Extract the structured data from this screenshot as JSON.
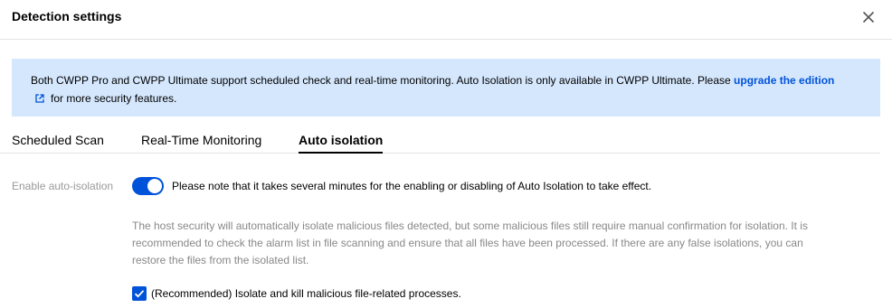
{
  "dialog": {
    "title": "Detection settings"
  },
  "notice": {
    "text_before_link": "Both CWPP Pro and CWPP Ultimate support scheduled check and real-time monitoring. Auto Isolation is only available in CWPP Ultimate. Please ",
    "link_label": "upgrade the edition",
    "text_after_link": "for more security features.",
    "background_color": "#d5e7fd",
    "link_color": "#0052d9"
  },
  "tabs": [
    {
      "label": "Scheduled Scan",
      "active": false
    },
    {
      "label": "Real-Time Monitoring",
      "active": false
    },
    {
      "label": "Auto isolation",
      "active": true
    }
  ],
  "auto_isolation": {
    "field_label": "Enable auto-isolation",
    "toggle_on": true,
    "toggle_note": "Please note that it takes several minutes for the enabling or disabling of Auto Isolation to take effect.",
    "description": "The host security will automatically isolate malicious files detected, but some malicious files still require manual confirmation for isolation. It is recommended to check the alarm list in file scanning and ensure that all files have been processed. If there are any false isolations, you can restore the files from the isolated list.",
    "checkbox_checked": true,
    "checkbox_label": "(Recommended) Isolate and kill malicious file-related processes."
  },
  "colors": {
    "accent": "#0052d9",
    "muted_text": "#999999"
  },
  "icons": {
    "close": "close-icon",
    "external_link": "external-link-icon",
    "check": "check-icon"
  }
}
